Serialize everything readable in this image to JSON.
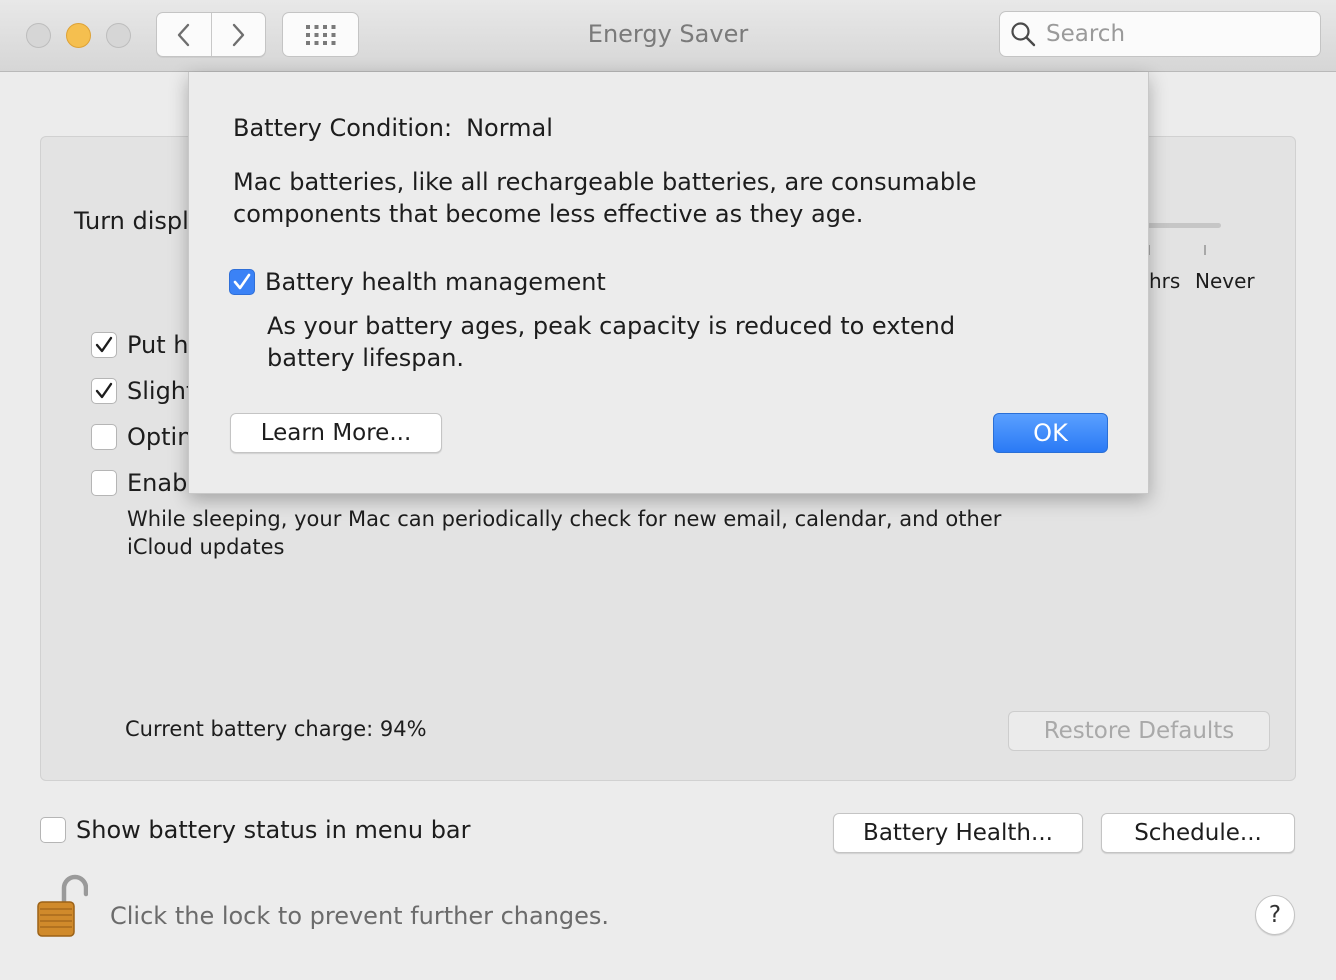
{
  "window": {
    "title": "Energy Saver",
    "search_placeholder": "Search"
  },
  "panel": {
    "turn_display_label": "Turn displ",
    "slider_tick_labels": [
      "hrs",
      "Never"
    ],
    "options": [
      {
        "label": "Put h",
        "checked": true
      },
      {
        "label": "Slight",
        "checked": true
      },
      {
        "label": "Optin",
        "checked": false
      },
      {
        "label": "Enab",
        "checked": false
      }
    ],
    "option_description": "While sleeping, your Mac can periodically check for new email, calendar, and other iCloud updates",
    "current_charge": "Current battery charge: 94%",
    "restore_defaults": "Restore Defaults"
  },
  "bottom": {
    "show_status_label": "Show battery status in menu bar",
    "show_status_checked": false,
    "battery_health_button": "Battery Health...",
    "schedule_button": "Schedule...",
    "lock_text": "Click the lock to prevent further changes.",
    "help_label": "?"
  },
  "sheet": {
    "condition_label": "Battery Condition:",
    "condition_value": "Normal",
    "info_text": "Mac batteries, like all rechargeable batteries, are consumable components that become less effective as they age.",
    "health_mgmt_label": "Battery health management",
    "health_mgmt_checked": true,
    "health_mgmt_desc": "As your battery ages, peak capacity is reduced to extend battery lifespan.",
    "learn_more": "Learn More...",
    "ok": "OK"
  },
  "colors": {
    "accent": "#2a7af5",
    "minimize": "#f5bf4f",
    "lock": "#d08a2b"
  },
  "icons": [
    "chevron-left-icon",
    "chevron-right-icon",
    "grid-icon",
    "search-icon",
    "checkmark-icon",
    "lock-icon"
  ]
}
